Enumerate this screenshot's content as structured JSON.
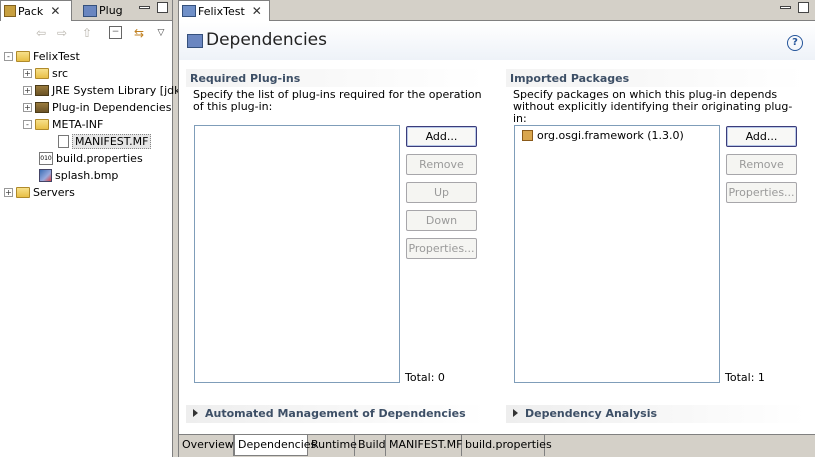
{
  "left_view": {
    "tabs": [
      {
        "label": "Pack",
        "icon": "package-explorer-icon",
        "active": true
      },
      {
        "label": "Plug",
        "icon": "plugins-icon",
        "active": false
      }
    ],
    "toolbar": [
      "back-icon",
      "forward-icon",
      "up-icon",
      "collapse-all-icon",
      "link-with-editor-icon",
      "view-menu-icon"
    ],
    "tree": [
      {
        "label": "FelixTest",
        "icon": "project-icon",
        "expander": "-",
        "level": 0
      },
      {
        "label": "src",
        "icon": "source-folder-icon",
        "expander": "+",
        "level": 1
      },
      {
        "label": "JRE System Library [jdk",
        "icon": "library-icon",
        "expander": "+",
        "level": 1
      },
      {
        "label": "Plug-in Dependencies",
        "icon": "library-icon",
        "expander": "+",
        "level": 1
      },
      {
        "label": "META-INF",
        "icon": "folder-icon",
        "expander": "-",
        "level": 1
      },
      {
        "label": "MANIFEST.MF",
        "icon": "manifest-file-icon",
        "expander": "",
        "level": 2,
        "selected": true
      },
      {
        "label": "build.properties",
        "icon": "properties-file-icon",
        "expander": "",
        "level": 1
      },
      {
        "label": "splash.bmp",
        "icon": "image-file-icon",
        "expander": "",
        "level": 1
      },
      {
        "label": "Servers",
        "icon": "project-icon",
        "expander": "+",
        "level": 0
      }
    ]
  },
  "editor": {
    "tab_label": "FelixTest",
    "title": "Dependencies",
    "required": {
      "title": "Required Plug-ins",
      "description": "Specify the list of plug-ins required for the operation of this plug-in:",
      "items": [],
      "buttons": {
        "add": "Add...",
        "remove": "Remove",
        "up": "Up",
        "down": "Down",
        "properties": "Properties..."
      },
      "total": "Total: 0"
    },
    "imported": {
      "title": "Imported Packages",
      "description": "Specify packages on which this plug-in depends without explicitly identifying their originating plug-in:",
      "items": [
        "org.osgi.framework (1.3.0)"
      ],
      "buttons": {
        "add": "Add...",
        "remove": "Remove",
        "properties": "Properties..."
      },
      "total": "Total: 1"
    },
    "automated": {
      "title": "Automated Management of Dependencies"
    },
    "analysis": {
      "title": "Dependency Analysis"
    },
    "bottom_tabs": [
      "Overview",
      "Dependencies",
      "Runtime",
      "Build",
      "MANIFEST.MF",
      "build.properties"
    ],
    "active_bottom_tab": "Dependencies"
  }
}
